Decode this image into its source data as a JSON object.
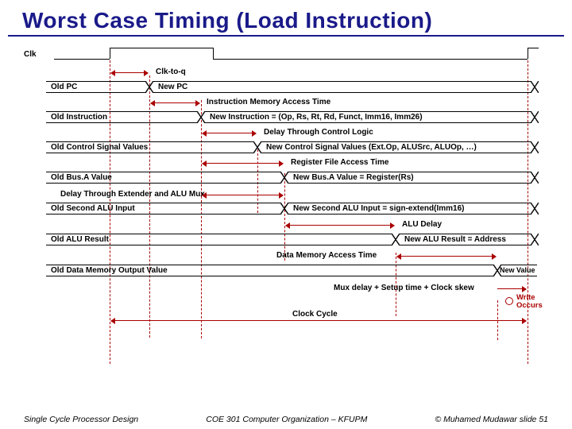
{
  "title": "Worst Case Timing (Load Instruction)",
  "clk_label": "Clk",
  "stages": {
    "clk_to_q": "Clk-to-q",
    "pc_old": "Old PC",
    "pc_new": "New PC",
    "imem": "Instruction Memory Access Time",
    "instr_old": "Old Instruction",
    "instr_new": "New Instruction = (Op, Rs, Rt, Rd, Funct, Imm16, Imm26)",
    "ctrl_delay": "Delay Through Control Logic",
    "ctrl_old": "Old Control Signal Values",
    "ctrl_new": "New Control Signal Values (Ext.Op, ALUSrc, ALUOp, …)",
    "regfile": "Register File Access Time",
    "busa_old": "Old Bus.A Value",
    "busa_new": "New Bus.A Value = Register(Rs)",
    "ext_mux": "Delay Through Extender and ALU Mux",
    "alu2_old": "Old Second ALU Input",
    "alu2_new": "New Second ALU Input = sign-extend(Imm16)",
    "alu_delay": "ALU Delay",
    "alu_old": "Old ALU Result",
    "alu_new": "New ALU Result = Address",
    "dmem": "Data Memory Access Time",
    "dm_old": "Old Data Memory Output Value",
    "dm_new": "New Value",
    "mux_setup": "Mux delay + Setup time + Clock skew",
    "clock_cycle": "Clock Cycle",
    "write_occurs": "Write Occurs"
  },
  "footer": {
    "left": "Single Cycle Processor Design",
    "center": "COE 301 Computer Organization – KFUPM",
    "right": "© Muhamed Mudawar   slide 51"
  },
  "geometry": {
    "left_edge": 70,
    "right_edge": 650,
    "t_clk_rise1": 110,
    "t_pc_new": 160,
    "t_instr_new": 225,
    "t_ctrl_new": 296,
    "t_busa_new": 330,
    "t_alu2_new": 330,
    "t_alu_new": 470,
    "t_dm_new": 598,
    "t_write": 636
  }
}
